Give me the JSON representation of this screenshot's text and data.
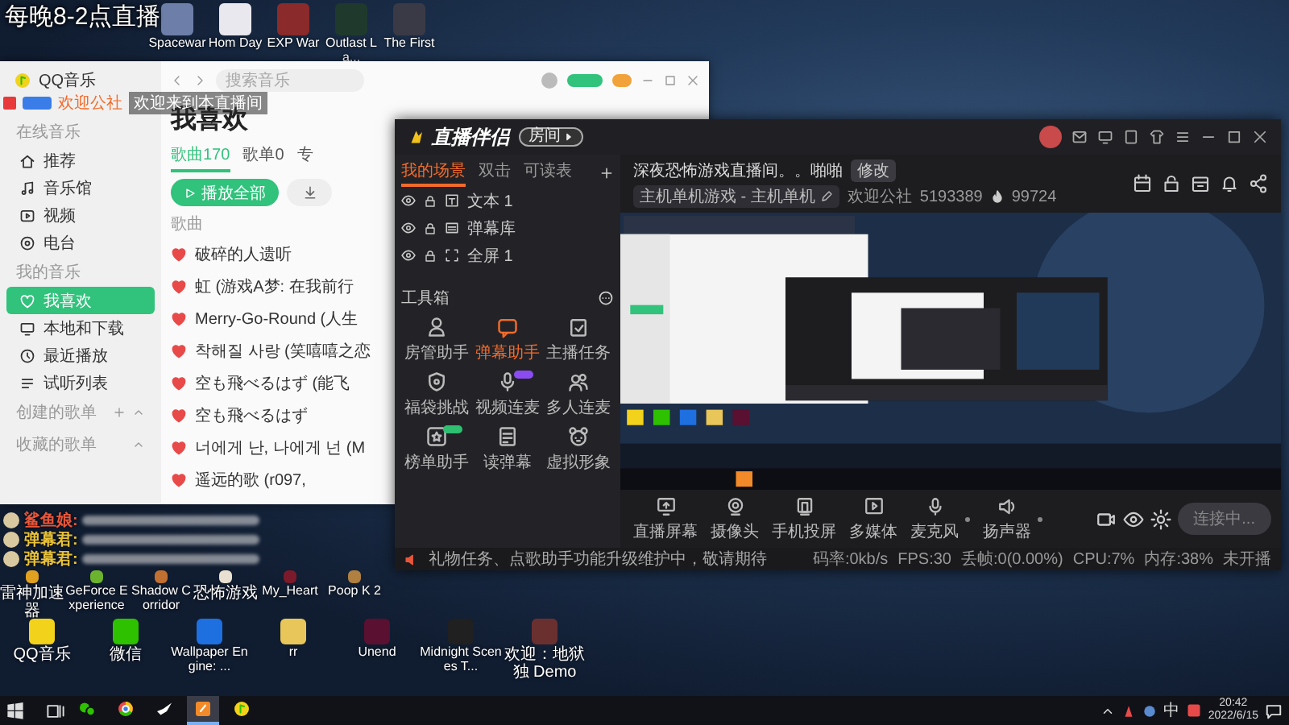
{
  "stream_overlay": {
    "title": "每晚8-2点直播",
    "banner": {
      "name": "欢迎公社",
      "message": "欢迎来到本直播间"
    },
    "chat": [
      {
        "name": "鲨鱼娘:",
        "color": "#e8563a"
      },
      {
        "name": "弹幕君:",
        "color": "#e8c23a"
      },
      {
        "name": "弹幕君:",
        "color": "#e8c23a"
      }
    ]
  },
  "desktop_icons_top": [
    {
      "label": "Spacewar",
      "color": "#6d7fa8"
    },
    {
      "label": "Hom Day",
      "color": "#e8e8ee"
    },
    {
      "label": "EXP War",
      "color": "#8a2a2a"
    },
    {
      "label": "Outlast La...",
      "color": "#1f3a2c"
    },
    {
      "label": "The First",
      "color": "#3a3a46"
    }
  ],
  "desktop_icons_row_1": [
    {
      "label": "雷神加速器",
      "color": "#e0a020"
    },
    {
      "label": "GeForce Experience",
      "color": "#6bb32e"
    },
    {
      "label": "Shadow Corridor",
      "color": "#c07030"
    },
    {
      "label": "恐怖游戏",
      "color": "#e8e0d0"
    },
    {
      "label": "My_Heart",
      "color": "#7a1a2a"
    },
    {
      "label": "Poop K 2",
      "color": "#b08040"
    }
  ],
  "desktop_icons_row_2": [
    {
      "label": "QQ音乐",
      "color": "#f2d21b"
    },
    {
      "label": "微信",
      "color": "#2dc100"
    },
    {
      "label": "Wallpaper Engine: ...",
      "color": "#1e6fe0"
    },
    {
      "label": "rr",
      "color": "#e8c65a"
    },
    {
      "label": "Unend",
      "color": "#5a1030"
    },
    {
      "label": "Midnight Scenes T...",
      "color": "#202020"
    },
    {
      "label": "欢迎：地狱独 Demo",
      "color": "#6a3030"
    }
  ],
  "qq_music": {
    "logo": "QQ音乐",
    "search": {
      "placeholder": "搜索音乐"
    },
    "sidebar": [
      {
        "heading": "在线音乐",
        "items": [
          {
            "label": "推荐",
            "selected": false
          },
          {
            "label": "音乐馆",
            "selected": false
          },
          {
            "label": "视频",
            "selected": false
          },
          {
            "label": "电台",
            "selected": false
          }
        ]
      },
      {
        "heading": "我的音乐",
        "items": [
          {
            "label": "我喜欢",
            "selected": true
          },
          {
            "label": "本地和下载",
            "selected": false
          },
          {
            "label": "最近播放",
            "selected": false
          },
          {
            "label": "试听列表",
            "selected": false
          }
        ]
      }
    ],
    "playlists": [
      {
        "label": "创建的歌单",
        "can_add": true
      },
      {
        "label": "收藏的歌单",
        "can_add": false
      }
    ],
    "page": {
      "title": "我喜欢",
      "tabs": [
        {
          "label": "歌曲170",
          "selected": true
        },
        {
          "label": "歌单0",
          "selected": false
        },
        {
          "label": "专",
          "selected": false
        }
      ],
      "play_all": "播放全部",
      "column": "歌曲",
      "songs": [
        {
          "title": "破碎的人遗听",
          "liked": true
        },
        {
          "title": "虹 (游戏A梦: 在我前行",
          "liked": true
        },
        {
          "title": "Merry-Go-Round (人生",
          "liked": true
        },
        {
          "title": "착해질 사랑 (笑嘻嘻之恋",
          "liked": true
        },
        {
          "title": "空も飛べるはず (能飞",
          "liked": true
        },
        {
          "title": "空も飛べるはず",
          "liked": true
        },
        {
          "title": "너에게 난, 나에게 넌 (M",
          "liked": true
        },
        {
          "title": "遥远的歌 (r097,",
          "liked": true
        }
      ]
    }
  },
  "stream_app": {
    "title": "直播伴侣",
    "room_badge": "房间",
    "scene_tabs": [
      {
        "label": "我的场景",
        "selected": true
      },
      {
        "label": "双击",
        "selected": false
      },
      {
        "label": "可读表",
        "selected": false
      }
    ],
    "layers": [
      {
        "name": "文本 1",
        "visible": true
      },
      {
        "name": "弹幕库",
        "visible": true
      },
      {
        "name": "全屏 1",
        "visible": true
      }
    ],
    "toolbox": {
      "title": "工具箱",
      "tools": [
        {
          "label": "房管助手",
          "selected": false
        },
        {
          "label": "弹幕助手",
          "selected": true
        },
        {
          "label": "主播任务",
          "selected": false
        },
        {
          "label": "福袋挑战",
          "selected": false
        },
        {
          "label": "视频连麦",
          "selected": false,
          "color": "#8a4cf0"
        },
        {
          "label": "多人连麦",
          "selected": false
        },
        {
          "label": "榜单助手",
          "selected": false,
          "color": "#2fbf71"
        },
        {
          "label": "读弹幕",
          "selected": false
        },
        {
          "label": "虚拟形象",
          "selected": false
        }
      ]
    },
    "room": {
      "title": "深夜恐怖游戏直播间。。啪啪",
      "edit": "修改",
      "category": "主机单机游戏 - 主机单机",
      "name": "欢迎公社",
      "room_id": "5193389",
      "popularity": "99724"
    },
    "sources": [
      {
        "label": "直播屏幕",
        "has_menu": false
      },
      {
        "label": "摄像头",
        "has_menu": false
      },
      {
        "label": "手机投屏",
        "has_menu": false
      },
      {
        "label": "多媒体",
        "has_menu": false
      },
      {
        "label": "麦克风",
        "has_menu": true
      },
      {
        "label": "扬声器",
        "has_menu": true
      }
    ],
    "live_button": "连接中...",
    "status": {
      "notice": "礼物任务、点歌助手功能升级维护中，敬请期待",
      "stats": [
        "码率:0kb/s",
        "FPS:30",
        "丢帧:0(0.00%)",
        "CPU:7%",
        "内存:38%"
      ],
      "live_state": "未开播"
    }
  },
  "taskbar": {
    "apps": [
      {
        "active": false
      },
      {
        "active": false
      },
      {
        "active": false
      },
      {
        "active": true
      },
      {
        "active": false
      }
    ],
    "ime": "中",
    "time": "20:42",
    "date": "2022/6/15"
  }
}
